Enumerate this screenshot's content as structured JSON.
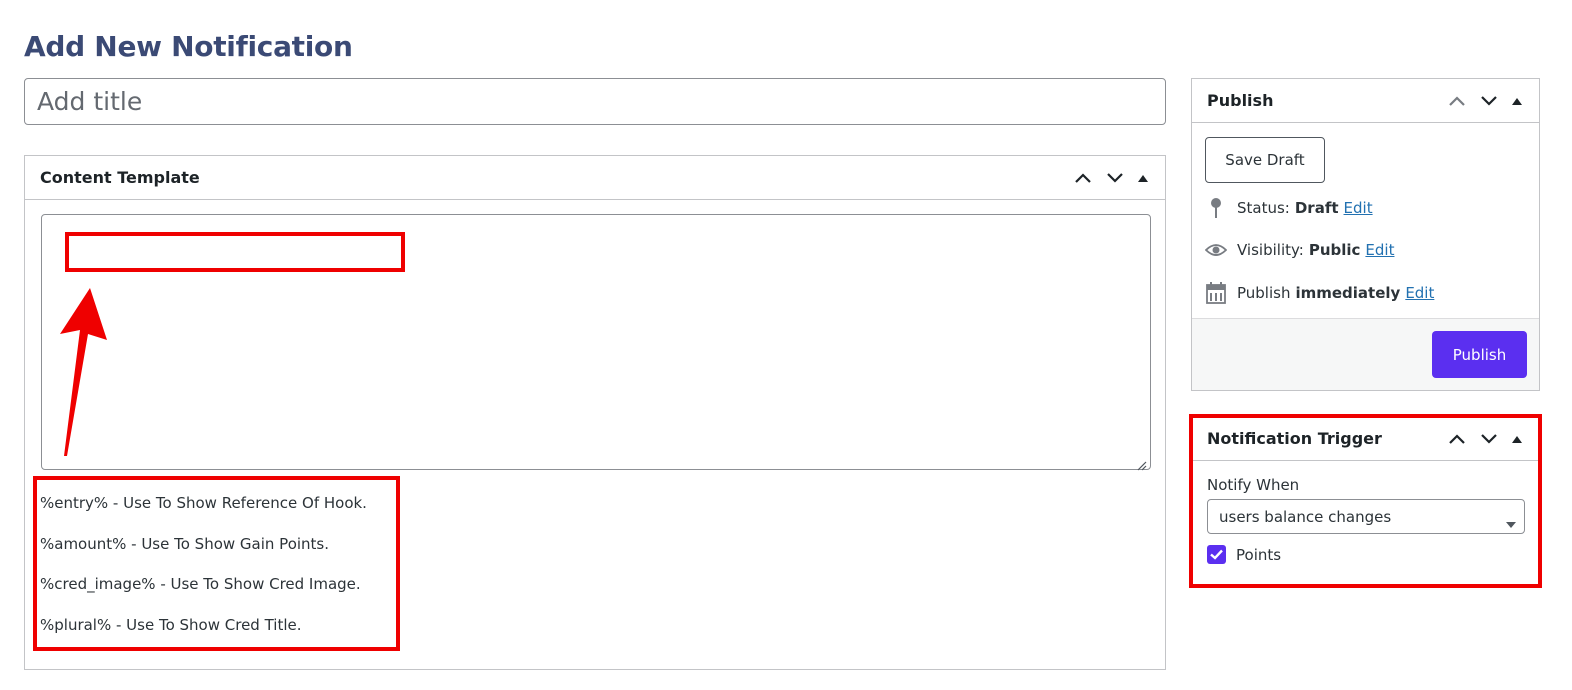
{
  "page": {
    "title": "Add New Notification"
  },
  "title_field": {
    "placeholder": "Add title",
    "value": ""
  },
  "content_template": {
    "title": "Content Template",
    "textarea_value": "",
    "help_lines": [
      "%entry% - Use To Show Reference Of Hook.",
      "%amount% - Use To Show Gain Points.",
      "%cred_image% - Use To Show Cred Image.",
      "%plural% - Use To Show Cred Title."
    ]
  },
  "publish": {
    "title": "Publish",
    "save_draft_label": "Save Draft",
    "status": {
      "label": "Status:",
      "value": "Draft",
      "link": "Edit"
    },
    "visibility": {
      "label": "Visibility:",
      "value": "Public",
      "link": "Edit"
    },
    "schedule": {
      "label": "Publish",
      "value": "immediately",
      "link": "Edit"
    },
    "publish_label": "Publish"
  },
  "trigger": {
    "title": "Notification Trigger",
    "notify_label": "Notify When",
    "select_value": "users balance changes",
    "checkbox_label": "Points",
    "checkbox_checked": true
  },
  "colors": {
    "title_color": "#3b4a75",
    "accent": "#5b2ff0",
    "annotation_red": "#ef0000",
    "link": "#2271b1"
  },
  "icons": {
    "move_up": "chevron-up-icon",
    "move_down": "chevron-down-icon",
    "toggle": "triangle-up-icon",
    "status": "pin-icon",
    "visibility": "eye-icon",
    "schedule": "calendar-icon",
    "checkbox": "checkmark-icon",
    "select": "caret-down-icon"
  }
}
